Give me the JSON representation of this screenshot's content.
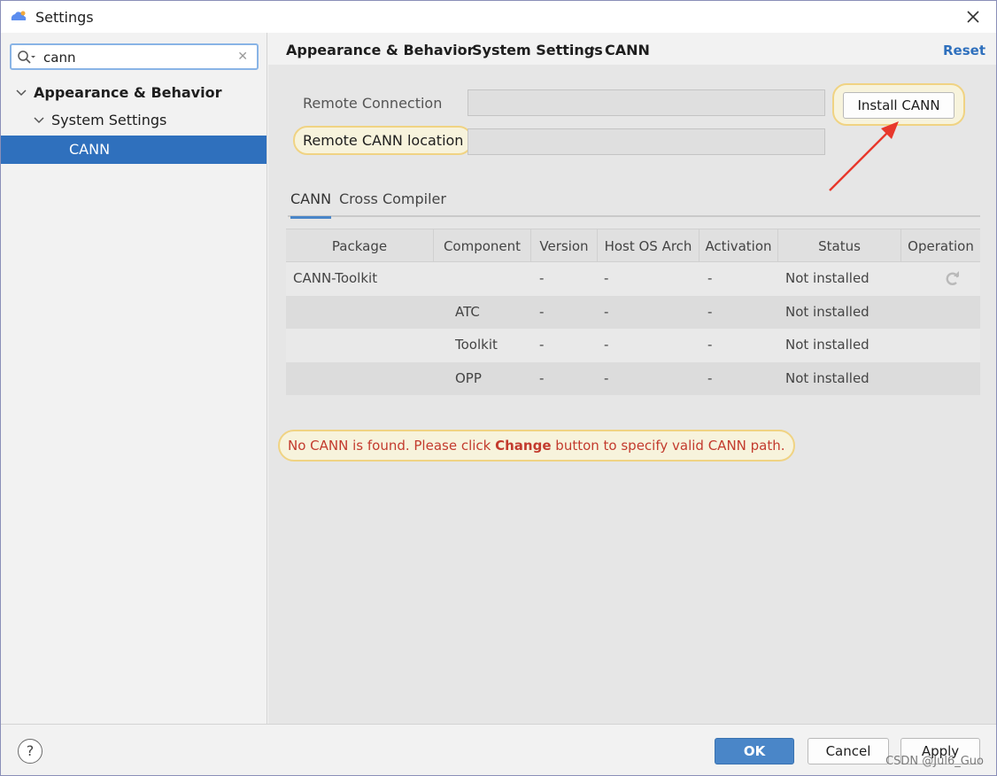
{
  "window": {
    "title": "Settings"
  },
  "search": {
    "value": "cann"
  },
  "sidebar": {
    "items": [
      {
        "label": "Appearance & Behavior"
      },
      {
        "label": "System Settings"
      },
      {
        "label": "CANN"
      }
    ]
  },
  "breadcrumb": [
    "Appearance & Behavior",
    "System Settings",
    "CANN"
  ],
  "header": {
    "reset_label": "Reset"
  },
  "fields": {
    "remote_connection_label": "Remote Connection",
    "remote_connection_value": "",
    "remote_cann_location_label": "Remote CANN location",
    "remote_cann_location_value": ""
  },
  "install_button": "Install CANN",
  "tabs": [
    {
      "label": "CANN",
      "active": true
    },
    {
      "label": "Cross Compiler",
      "active": false
    }
  ],
  "table": {
    "headers": [
      "Package",
      "Component",
      "Version",
      "Host OS Arch",
      "Activation",
      "Status",
      "Operation"
    ],
    "rows": [
      {
        "package": "CANN-Toolkit",
        "component": "",
        "version": "-",
        "arch": "-",
        "activation": "-",
        "status": "Not installed"
      },
      {
        "package": "",
        "component": "ATC",
        "version": "-",
        "arch": "-",
        "activation": "-",
        "status": "Not installed"
      },
      {
        "package": "",
        "component": "Toolkit",
        "version": "-",
        "arch": "-",
        "activation": "-",
        "status": "Not installed"
      },
      {
        "package": "",
        "component": "OPP",
        "version": "-",
        "arch": "-",
        "activation": "-",
        "status": "Not installed"
      }
    ],
    "operation_icon": "refresh-icon"
  },
  "error": {
    "prefix": "No CANN is found. Please click ",
    "bold": "Change",
    "suffix": " button to specify valid CANN path."
  },
  "footer": {
    "help_label": "?",
    "ok_label": "OK",
    "cancel_label": "Cancel",
    "apply_label": "Apply",
    "watermark": "CSDN @Jul6_Guo"
  },
  "colors": {
    "accent": "#2f70bd",
    "primary_button": "#4a86c8",
    "error_text": "#c33b2e",
    "highlight_fill": "#f7f3dc",
    "highlight_border": "#f0d383",
    "annotation_arrow": "#e8382c"
  }
}
